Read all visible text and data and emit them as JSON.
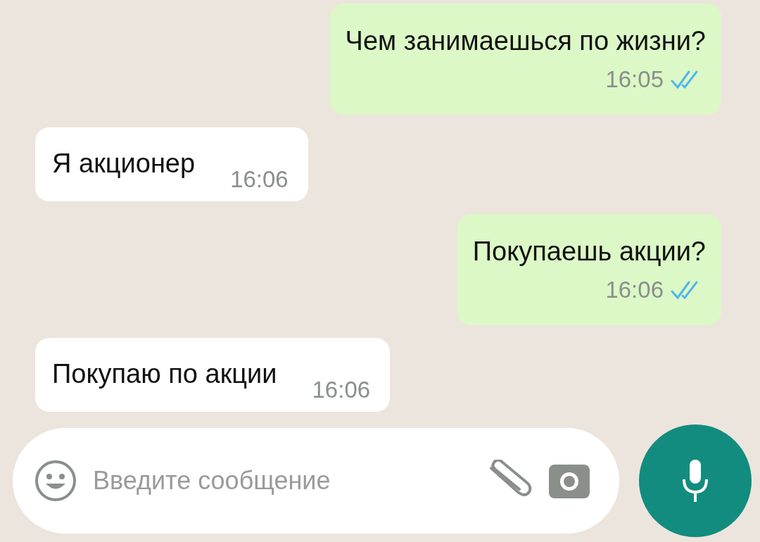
{
  "messages": [
    {
      "kind": "out",
      "text": "Чем занимаешься по жизни?",
      "time": "16:05",
      "read": true
    },
    {
      "kind": "in",
      "text": "Я акционер",
      "time": "16:06"
    },
    {
      "kind": "out",
      "text": "Покупаешь акции?",
      "time": "16:06",
      "read": true
    },
    {
      "kind": "in",
      "text": "Покупаю по акции",
      "time": "16:06"
    }
  ],
  "composer": {
    "placeholder": "Введите сообщение"
  }
}
